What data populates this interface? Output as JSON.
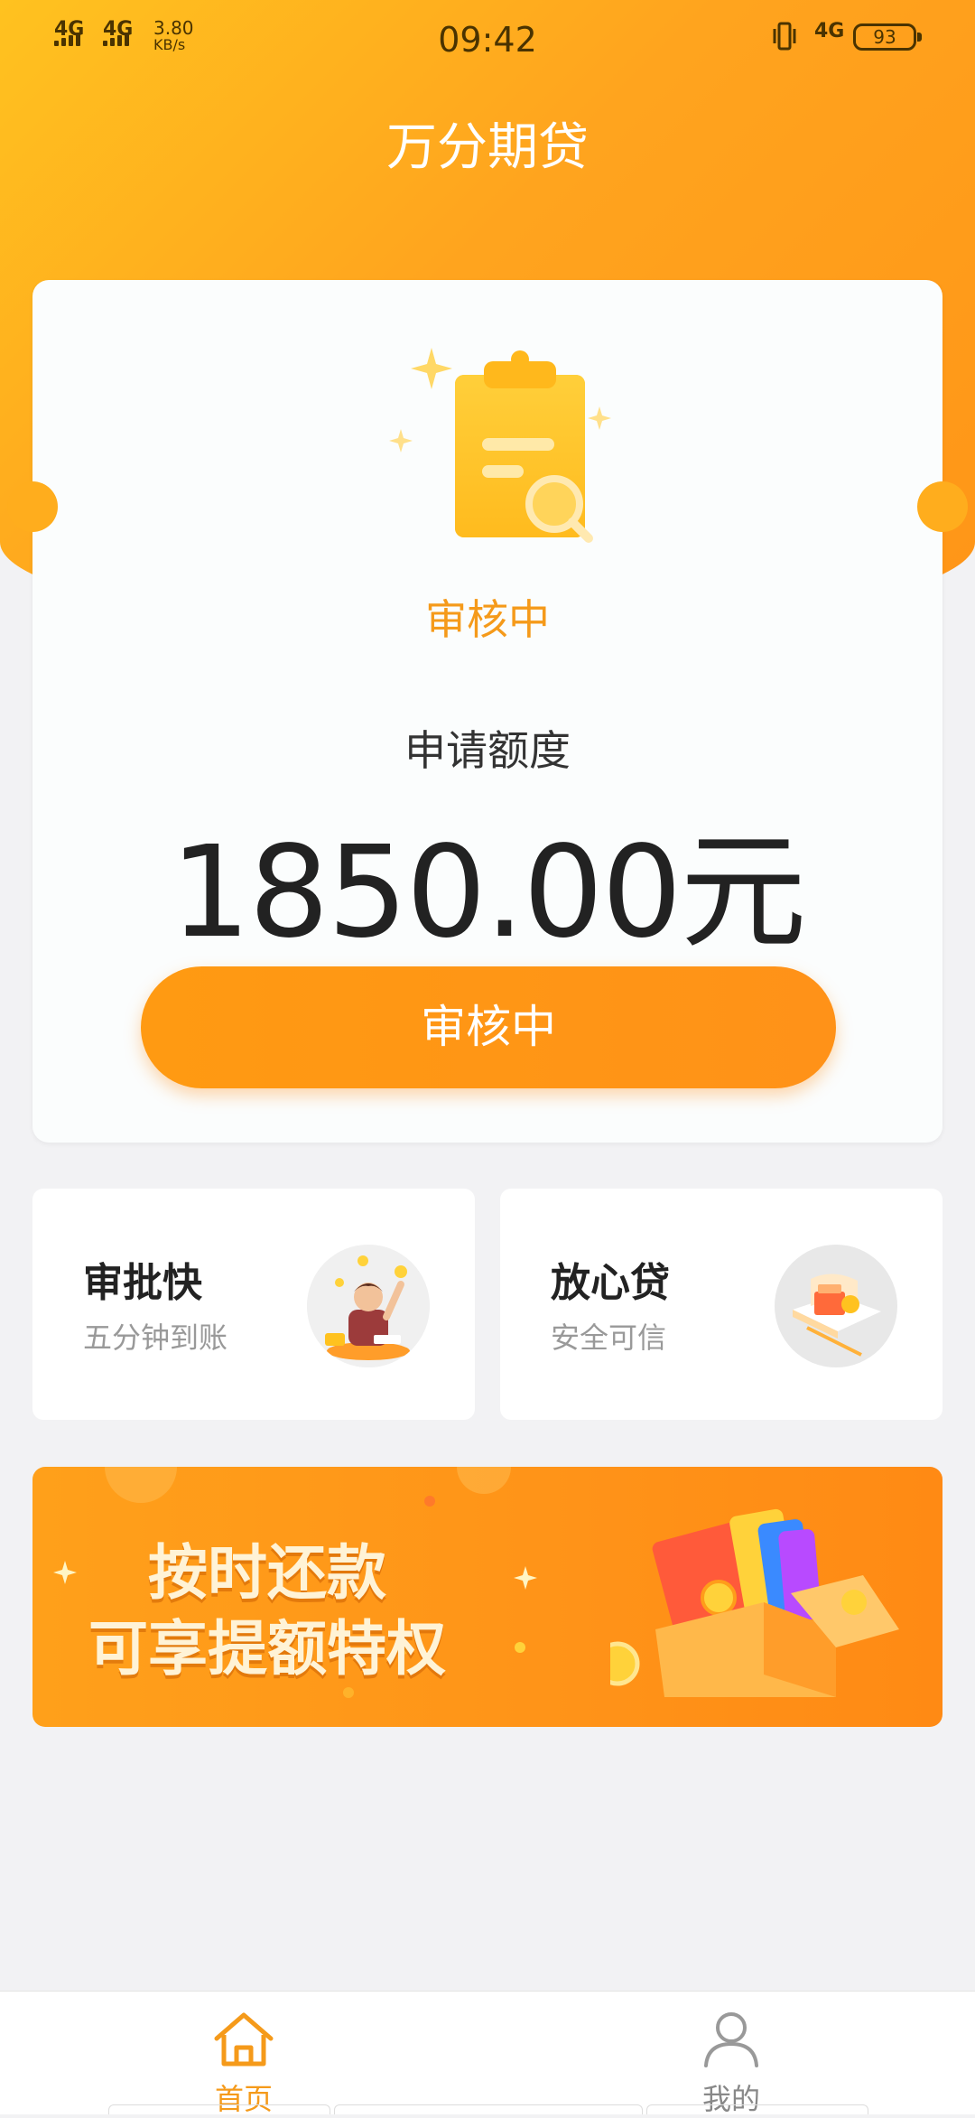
{
  "status_bar": {
    "network1": "4G",
    "network2": "4G",
    "speed_value": "3.80",
    "speed_unit": "KB/s",
    "time": "09:42",
    "network_right": "4G",
    "battery": "93"
  },
  "header": {
    "title": "万分期贷"
  },
  "card": {
    "status_label": "审核中",
    "apply_label": "申请额度",
    "apply_amount": "1850.00元",
    "button_label": "审核中"
  },
  "features": [
    {
      "title": "审批快",
      "subtitle": "五分钟到账",
      "icon": "happy-man-illustration"
    },
    {
      "title": "放心贷",
      "subtitle": "安全可信",
      "icon": "bank-book-illustration"
    }
  ],
  "banner": {
    "line1": "按时还款",
    "line2": "可享提额特权"
  },
  "tabs": [
    {
      "label": "首页",
      "icon": "home-icon",
      "active": true
    },
    {
      "label": "我的",
      "icon": "user-icon",
      "active": false
    }
  ],
  "colors": {
    "accent": "#ff9a12",
    "background": "#f2f2f4"
  }
}
